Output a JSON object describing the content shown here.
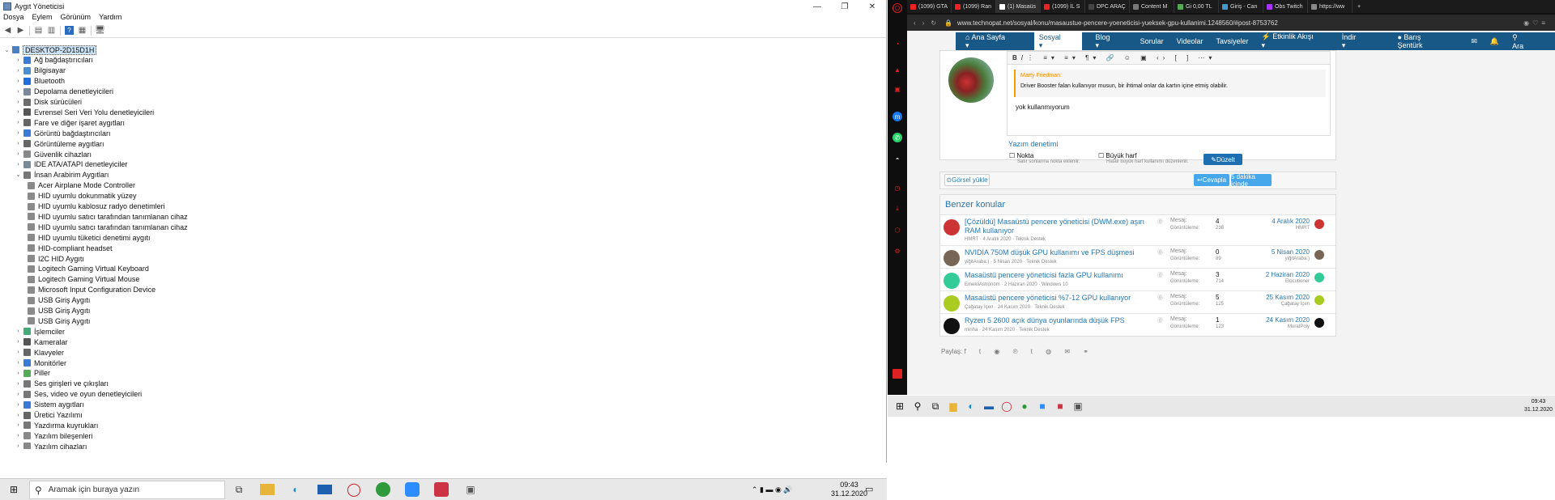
{
  "devmgr": {
    "title": "Aygıt Yöneticisi",
    "window_buttons": [
      "—",
      "❐",
      "✕"
    ],
    "menu": [
      "Dosya",
      "Eylem",
      "Görünüm",
      "Yardım"
    ],
    "root": "DESKTOP-2D15D1H",
    "items": [
      {
        "label": "Ağ bağdaştırıcıları",
        "exp": "›",
        "color": "#3a7bd5"
      },
      {
        "label": "Bilgisayar",
        "exp": "›",
        "color": "#4a8fd0"
      },
      {
        "label": "Bluetooth",
        "exp": "›",
        "color": "#1e6fd9"
      },
      {
        "label": "Depolama denetleyicileri",
        "exp": "›",
        "color": "#7a8a99"
      },
      {
        "label": "Disk sürücüleri",
        "exp": "›",
        "color": "#6b6b6b"
      },
      {
        "label": "Evrensel Seri Veri Yolu denetleyicileri",
        "exp": "›",
        "color": "#555"
      },
      {
        "label": "Fare ve diğer işaret aygıtları",
        "exp": "›",
        "color": "#666"
      },
      {
        "label": "Görüntü bağdaştırıcıları",
        "exp": "›",
        "color": "#3a7bd5"
      },
      {
        "label": "Görüntüleme aygıtları",
        "exp": "›",
        "color": "#666"
      },
      {
        "label": "Güvenlik cihazları",
        "exp": "›",
        "color": "#888"
      },
      {
        "label": "IDE ATA/ATAPI denetleyiciler",
        "exp": "›",
        "color": "#7a8a99"
      },
      {
        "label": "İnsan Arabirim Aygıtları",
        "exp": "⌄",
        "color": "#777"
      }
    ],
    "hid_children": [
      "Acer Airplane Mode Controller",
      "HID uyumlu dokunmatik yüzey",
      "HID uyumlu kablosuz radyo denetimleri",
      "HID uyumlu satıcı tarafından tanımlanan cihaz",
      "HID uyumlu satıcı tarafından tanımlanan cihaz",
      "HID uyumlu tüketici denetimi aygıtı",
      "HID-compliant headset",
      "I2C HID Aygıtı",
      "Logitech Gaming Virtual Keyboard",
      "Logitech Gaming Virtual Mouse",
      "Microsoft Input Configuration Device",
      "USB Giriş Aygıtı",
      "USB Giriş Aygıtı",
      "USB Giriş Aygıtı"
    ],
    "items_after": [
      {
        "label": "İşlemciler",
        "color": "#4a7"
      },
      {
        "label": "Kameralar",
        "color": "#555"
      },
      {
        "label": "Klavyeler",
        "color": "#666"
      },
      {
        "label": "Monitörler",
        "color": "#3a7bd5"
      },
      {
        "label": "Piller",
        "color": "#5a5"
      },
      {
        "label": "Ses girişleri ve çıkışları",
        "color": "#777"
      },
      {
        "label": "Ses, video ve oyun denetleyicileri",
        "color": "#777"
      },
      {
        "label": "Sistem aygıtları",
        "color": "#3a7bd5"
      },
      {
        "label": "Üretici Yazılımı",
        "color": "#666"
      },
      {
        "label": "Yazdırma kuyrukları",
        "color": "#777"
      },
      {
        "label": "Yazılım bileşenleri",
        "color": "#888"
      },
      {
        "label": "Yazılım cihazları",
        "color": "#888"
      }
    ]
  },
  "taskbar": {
    "search_placeholder": "Aramak için buraya yazın",
    "time": "09:43",
    "date": "31.12.2020"
  },
  "browser": {
    "tabs": [
      {
        "t": "(1099) GTA",
        "c": "#e22"
      },
      {
        "t": "(1099) Ran",
        "c": "#e22"
      },
      {
        "t": "(1) Masaüs",
        "c": "#fff"
      },
      {
        "t": "(1099) İL S",
        "c": "#e22"
      },
      {
        "t": "DPC ARAÇ",
        "c": "#444"
      },
      {
        "t": "Content M",
        "c": "#777"
      },
      {
        "t": "Gi 0,00 TL",
        "c": "#5a5"
      },
      {
        "t": "Giriş - Can",
        "c": "#49c"
      },
      {
        "t": "Obs Twitch",
        "c": "#a3f"
      },
      {
        "t": "https://ww",
        "c": "#888"
      }
    ],
    "url": "www.technopat.net/sosyal/konu/masaustue-pencere-yoeneticisi-yueksek-gpu-kullanimi.1248560/#post-8753762",
    "nav": [
      "Ana Sayfa",
      "Sosyal",
      "Blog",
      "Sorular",
      "Videolar",
      "Tavsiyeler",
      "Etkinlik Akışı",
      "İndir"
    ],
    "user": "Barış Şentürk",
    "search": "Ara",
    "quote_author": "Marty Friedman:",
    "quote_text": "Driver Booster falan kullanıyor musun, bir ihtimal onlar da kartın içine etmiş olabilir.",
    "reply": "yok kullanmıyorum",
    "spell_title": "Yazım denetimi",
    "opt1": "Nokta",
    "opt1_sub": "Satır sonlarına nokta ekleniir.",
    "opt2": "Büyük harf",
    "opt2_sub": "Hatalı büyük harf kullanımı düzenlenir.",
    "fix": "Düzelt",
    "upload": "Görsel yükle",
    "reply_btn": "Cevapla",
    "in_5": "5 dakika içinde",
    "similar": "Benzer konular",
    "threads": [
      {
        "title": "[Çözüldü] Masaüstü pencere yöneticisi (DWM.exe) aşırı RAM kullanıyor",
        "meta": "HMRT · 4 Aralık 2020 · Teknik Destek",
        "msg": "4",
        "views": "238",
        "date": "4 Aralık 2020",
        "user": "HMRT",
        "col": "#c33",
        "h": 38
      },
      {
        "title": "NVIDIA 750M düşük GPU kullanımı ve FPS düşmesi",
        "meta": "yiğitAraba:) · 5 Nisan 2020 · Teknik Destek",
        "msg": "0",
        "views": "89",
        "date": "5 Nisan 2020",
        "user": "yiğitAraba:)",
        "col": "#765",
        "h": 28
      },
      {
        "title": "Masaüstü pencere yöneticisi fazla GPU kullanımı",
        "meta": "EmekliAstronom · 2 Haziran 2020 · Windows 10",
        "msg": "3",
        "views": "714",
        "date": "2 Haziran 2020",
        "user": "Elocutioner",
        "col": "#3c9",
        "h": 28
      },
      {
        "title": "Masaüstü pencere yöneticisi %7-12 GPU kullanıyor",
        "meta": "Çağatay İçen · 24 Kasım 2020 · Teknik Destek",
        "msg": "5",
        "views": "125",
        "date": "25 Kasım 2020",
        "user": "Çağatay İçen",
        "col": "#ac2",
        "h": 28
      },
      {
        "title": "Ryzen 5 2600 açık dünya oyunlarında düşük FPS",
        "meta": "minha · 24 Kasım 2020 · Teknik Destek",
        "msg": "1",
        "views": "123",
        "date": "24 Kasım 2020",
        "user": "MuratPoly",
        "col": "#111",
        "h": 28
      }
    ],
    "msg_label": "Mesaj:",
    "views_label": "Görüntüleme:",
    "share": "Paylaş:",
    "time": "09:43",
    "date": "31.12.2020"
  }
}
